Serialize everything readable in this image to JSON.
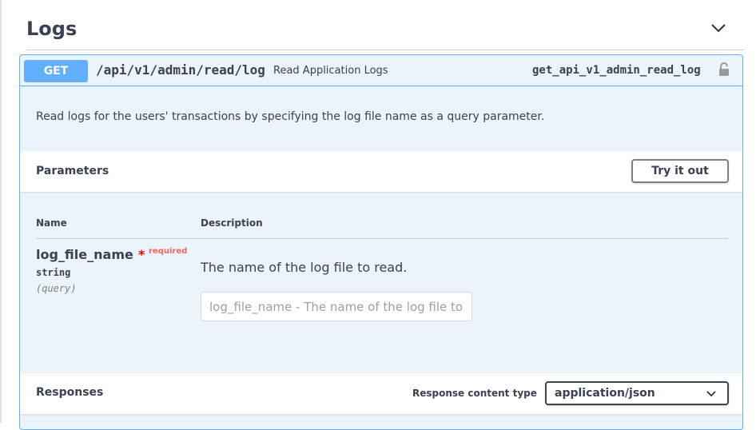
{
  "section": {
    "title": "Logs"
  },
  "operation": {
    "method": "GET",
    "path": "/api/v1/admin/read/log",
    "summary": "Read Application Logs",
    "operation_id": "get_api_v1_admin_read_log",
    "description": "Read logs for the users' transactions by specifying the log file name as a query parameter.",
    "method_color": "#61affe"
  },
  "parameters": {
    "title": "Parameters",
    "try_button": "Try it out",
    "columns": {
      "name": "Name",
      "description": "Description"
    },
    "items": [
      {
        "name": "log_file_name",
        "required_star": "*",
        "required_label": "required",
        "type": "string",
        "in": "(query)",
        "description": "The name of the log file to read.",
        "placeholder": "log_file_name - The name of the log file to read."
      }
    ]
  },
  "responses": {
    "title": "Responses",
    "content_type_label": "Response content type",
    "content_type_value": "application/json"
  },
  "icons": {
    "collapse": "chevron-down-icon",
    "lock": "lock-icon",
    "select_arrow": "chevron-down-icon"
  }
}
